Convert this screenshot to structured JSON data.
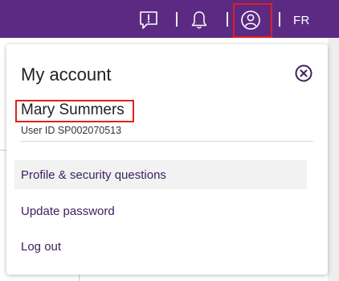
{
  "header": {
    "language": "FR",
    "icons": {
      "feedback": "feedback-icon",
      "notifications": "bell-icon",
      "account": "account-icon"
    },
    "accent_color": "#5c2a83"
  },
  "account_menu": {
    "title": "My account",
    "close_icon": "close-circle-icon",
    "user_name": "Mary Summers",
    "user_id": "User ID SP002070513",
    "items": [
      {
        "label": "Profile & security questions"
      },
      {
        "label": "Update password"
      },
      {
        "label": "Log out"
      }
    ]
  },
  "colors": {
    "highlight_box": "#e02020",
    "menu_text": "#3d2160"
  }
}
